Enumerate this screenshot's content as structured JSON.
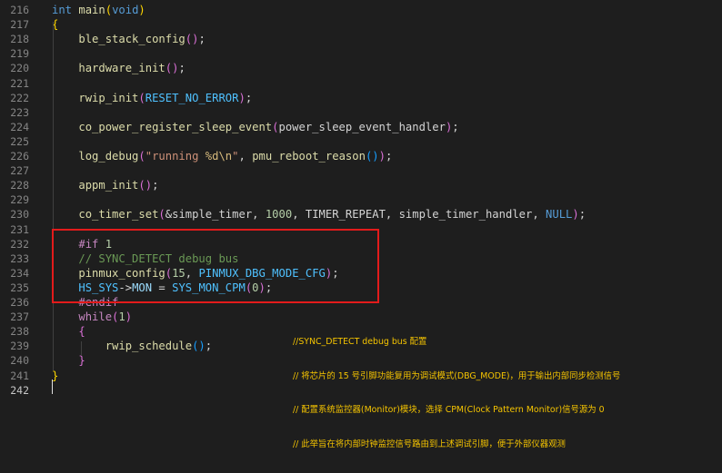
{
  "editor": {
    "lines": [
      {
        "n": "216",
        "tokens": [
          {
            "c": "kw",
            "t": "int"
          },
          {
            "c": "txt",
            "t": " "
          },
          {
            "c": "fn",
            "t": "main"
          },
          {
            "c": "br1",
            "t": "("
          },
          {
            "c": "kw",
            "t": "void"
          },
          {
            "c": "br1",
            "t": ")"
          }
        ]
      },
      {
        "n": "217",
        "tokens": [
          {
            "c": "br1",
            "t": "{"
          }
        ]
      },
      {
        "n": "218",
        "tokens": [
          {
            "c": "txt",
            "t": "    "
          },
          {
            "c": "fn",
            "t": "ble_stack_config"
          },
          {
            "c": "br2",
            "t": "()"
          },
          {
            "c": "txt",
            "t": ";"
          }
        ]
      },
      {
        "n": "219",
        "tokens": []
      },
      {
        "n": "220",
        "tokens": [
          {
            "c": "txt",
            "t": "    "
          },
          {
            "c": "fn",
            "t": "hardware_init"
          },
          {
            "c": "br2",
            "t": "()"
          },
          {
            "c": "txt",
            "t": ";"
          }
        ]
      },
      {
        "n": "221",
        "tokens": []
      },
      {
        "n": "222",
        "tokens": [
          {
            "c": "txt",
            "t": "    "
          },
          {
            "c": "fn",
            "t": "rwip_init"
          },
          {
            "c": "br2",
            "t": "("
          },
          {
            "c": "mac",
            "t": "RESET_NO_ERROR"
          },
          {
            "c": "br2",
            "t": ")"
          },
          {
            "c": "txt",
            "t": ";"
          }
        ]
      },
      {
        "n": "223",
        "tokens": []
      },
      {
        "n": "224",
        "tokens": [
          {
            "c": "txt",
            "t": "    "
          },
          {
            "c": "fn",
            "t": "co_power_register_sleep_event"
          },
          {
            "c": "br2",
            "t": "("
          },
          {
            "c": "txt",
            "t": "power_sleep_event_handler"
          },
          {
            "c": "br2",
            "t": ")"
          },
          {
            "c": "txt",
            "t": ";"
          }
        ]
      },
      {
        "n": "225",
        "tokens": []
      },
      {
        "n": "226",
        "tokens": [
          {
            "c": "txt",
            "t": "    "
          },
          {
            "c": "fn",
            "t": "log_debug"
          },
          {
            "c": "br2",
            "t": "("
          },
          {
            "c": "str",
            "t": "\"running "
          },
          {
            "c": "esc",
            "t": "%d\\n"
          },
          {
            "c": "str",
            "t": "\""
          },
          {
            "c": "txt",
            "t": ", "
          },
          {
            "c": "fn",
            "t": "pmu_reboot_reason"
          },
          {
            "c": "br3",
            "t": "()"
          },
          {
            "c": "br2",
            "t": ")"
          },
          {
            "c": "txt",
            "t": ";"
          }
        ]
      },
      {
        "n": "227",
        "tokens": []
      },
      {
        "n": "228",
        "tokens": [
          {
            "c": "txt",
            "t": "    "
          },
          {
            "c": "fn",
            "t": "appm_init"
          },
          {
            "c": "br2",
            "t": "()"
          },
          {
            "c": "txt",
            "t": ";"
          }
        ]
      },
      {
        "n": "229",
        "tokens": []
      },
      {
        "n": "230",
        "tokens": [
          {
            "c": "txt",
            "t": "    "
          },
          {
            "c": "fn",
            "t": "co_timer_set"
          },
          {
            "c": "br2",
            "t": "("
          },
          {
            "c": "txt",
            "t": "&simple_timer, "
          },
          {
            "c": "num",
            "t": "1000"
          },
          {
            "c": "txt",
            "t": ", TIMER_REPEAT, simple_timer_handler, "
          },
          {
            "c": "kw",
            "t": "NULL"
          },
          {
            "c": "br2",
            "t": ")"
          },
          {
            "c": "txt",
            "t": ";"
          }
        ]
      },
      {
        "n": "231",
        "tokens": []
      },
      {
        "n": "232",
        "tokens": [
          {
            "c": "txt",
            "t": "    "
          },
          {
            "c": "pre",
            "t": "#if"
          },
          {
            "c": "txt",
            "t": " "
          },
          {
            "c": "num",
            "t": "1"
          }
        ]
      },
      {
        "n": "233",
        "tokens": [
          {
            "c": "txt",
            "t": "    "
          },
          {
            "c": "cmt",
            "t": "// SYNC_DETECT debug bus"
          }
        ]
      },
      {
        "n": "234",
        "tokens": [
          {
            "c": "txt",
            "t": "    "
          },
          {
            "c": "fn",
            "t": "pinmux_config"
          },
          {
            "c": "br2",
            "t": "("
          },
          {
            "c": "num",
            "t": "15"
          },
          {
            "c": "txt",
            "t": ", "
          },
          {
            "c": "mac",
            "t": "PINMUX_DBG_MODE_CFG"
          },
          {
            "c": "br2",
            "t": ")"
          },
          {
            "c": "txt",
            "t": ";"
          }
        ]
      },
      {
        "n": "235",
        "tokens": [
          {
            "c": "txt",
            "t": "    "
          },
          {
            "c": "mac",
            "t": "HS_SYS"
          },
          {
            "c": "txt",
            "t": "->"
          },
          {
            "c": "var",
            "t": "MON"
          },
          {
            "c": "txt",
            "t": " = "
          },
          {
            "c": "mac",
            "t": "SYS_MON_CPM"
          },
          {
            "c": "br2",
            "t": "("
          },
          {
            "c": "num",
            "t": "0"
          },
          {
            "c": "br2",
            "t": ")"
          },
          {
            "c": "txt",
            "t": ";"
          }
        ]
      },
      {
        "n": "236",
        "tokens": [
          {
            "c": "txt",
            "t": "    "
          },
          {
            "c": "pre",
            "t": "#endif"
          }
        ]
      },
      {
        "n": "237",
        "tokens": [
          {
            "c": "txt",
            "t": "    "
          },
          {
            "c": "pre",
            "t": "while"
          },
          {
            "c": "br2",
            "t": "("
          },
          {
            "c": "num",
            "t": "1"
          },
          {
            "c": "br2",
            "t": ")"
          }
        ]
      },
      {
        "n": "238",
        "tokens": [
          {
            "c": "txt",
            "t": "    "
          },
          {
            "c": "br2",
            "t": "{"
          }
        ]
      },
      {
        "n": "239",
        "tokens": [
          {
            "c": "txt",
            "t": "        "
          },
          {
            "c": "fn",
            "t": "rwip_schedule"
          },
          {
            "c": "br3",
            "t": "()"
          },
          {
            "c": "txt",
            "t": ";"
          }
        ]
      },
      {
        "n": "240",
        "tokens": [
          {
            "c": "txt",
            "t": "    "
          },
          {
            "c": "br2",
            "t": "}"
          }
        ]
      },
      {
        "n": "241",
        "tokens": [
          {
            "c": "br1",
            "t": "}"
          }
        ]
      },
      {
        "n": "242",
        "tokens": [],
        "active": true
      }
    ]
  },
  "annotation": {
    "lines": [
      "//SYNC_DETECT debug bus 配置",
      "// 将芯片的 15 号引脚功能复用为调试模式(DBG_MODE)，用于输出内部同步检测信号",
      "// 配置系统监控器(Monitor)模块，选择 CPM(Clock Pattern Monitor)信号源为 0",
      "// 此举旨在将内部时钟监控信号路由到上述调试引脚，便于外部仪器观测"
    ]
  },
  "colors": {
    "background": "#1e1e1e",
    "highlight_border": "#e31b1b",
    "annotation_text": "#f5c400"
  }
}
